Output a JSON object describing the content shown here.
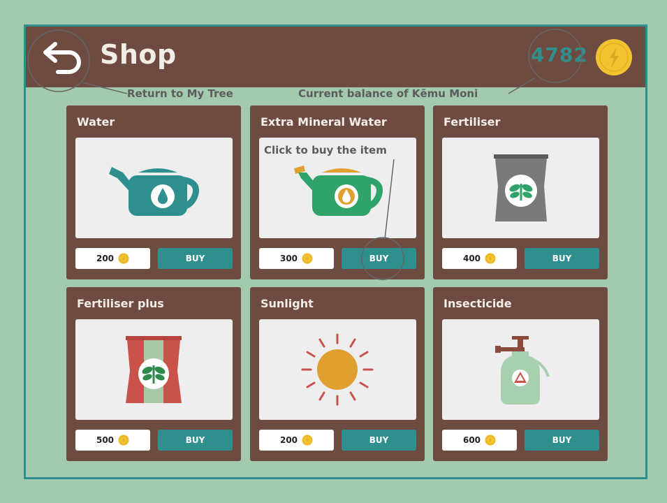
{
  "header": {
    "title": "Shop",
    "balance": "4782"
  },
  "annotations": {
    "back": "Return to My Tree",
    "balance": "Current balance of Kēmu Moni",
    "buy": "Click to buy the item"
  },
  "items": [
    {
      "name": "Water",
      "price": "200",
      "buy_label": "BUY",
      "icon": "watering-can-icon"
    },
    {
      "name": "Extra Mineral Water",
      "price": "300",
      "buy_label": "BUY",
      "icon": "mineral-watering-can-icon"
    },
    {
      "name": "Fertiliser",
      "price": "400",
      "buy_label": "BUY",
      "icon": "fertiliser-bag-icon"
    },
    {
      "name": "Fertiliser plus",
      "price": "500",
      "buy_label": "BUY",
      "icon": "fertiliser-plus-bag-icon"
    },
    {
      "name": "Sunlight",
      "price": "200",
      "buy_label": "BUY",
      "icon": "sun-icon"
    },
    {
      "name": "Insecticide",
      "price": "600",
      "buy_label": "BUY",
      "icon": "spray-bottle-icon"
    }
  ],
  "colors": {
    "background": "#a3c9af",
    "header": "#6e4b40",
    "accent": "#2f8f8f",
    "coin": "#f2c330"
  }
}
